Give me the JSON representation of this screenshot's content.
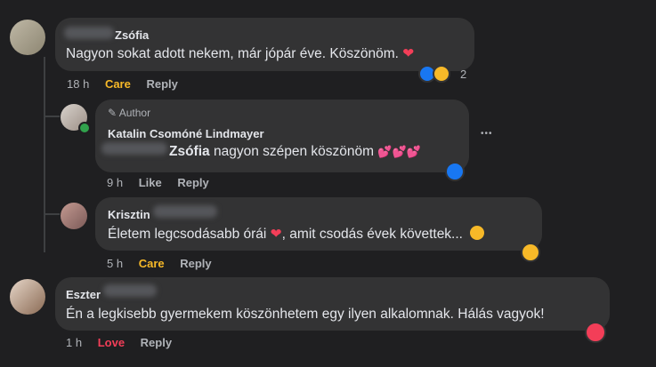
{
  "comments": [
    {
      "author": "Zsófia",
      "text": "Nagyon sokat adott nekem, már jópár éve. Köszönöm.",
      "time": "18 h",
      "reaction_action": "Care",
      "reply": "Reply",
      "reaction_count": "2"
    },
    {
      "author_badge": "Author",
      "author": "Katalin Csomóné Lindmayer",
      "mention": "Zsófia",
      "text": " nagyon szépen köszönöm",
      "time": "9 h",
      "reaction_action": "Like",
      "reply": "Reply",
      "more": "•••"
    },
    {
      "author": "Krisztin",
      "text": "Életem legcsodásabb órái",
      "text_after": ", amit csodás évek követtek...",
      "time": "5 h",
      "reaction_action": "Care",
      "reply": "Reply"
    },
    {
      "author": "Eszter",
      "text": "Én a legkisebb gyermekem köszönhetem egy ilyen alkalomnak. Hálás vagyok!",
      "time": "1 h",
      "reaction_action": "Love",
      "reply": "Reply"
    }
  ],
  "colors": {
    "background": "#1f1f21",
    "bubble": "#333334",
    "care": "#f7b928",
    "love": "#f33e58",
    "like": "#1877f2"
  },
  "icons": [
    "heart-icon",
    "like-icon",
    "care-icon",
    "love-icon",
    "pencil-icon",
    "more-icon",
    "smile-icon",
    "online-dot-icon"
  ]
}
